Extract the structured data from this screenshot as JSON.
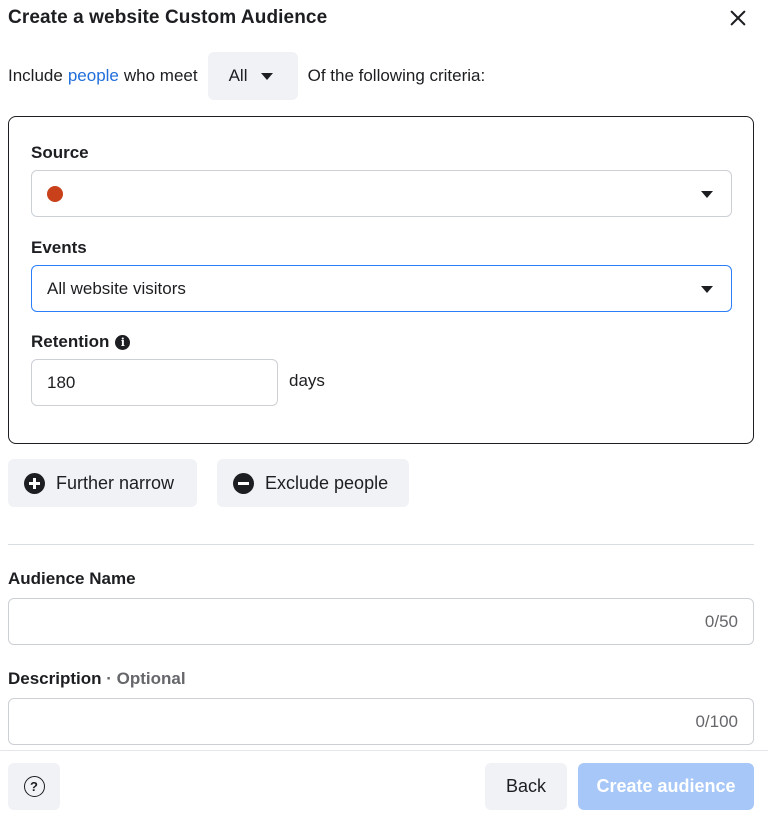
{
  "dialog": {
    "title": "Create a website Custom Audience",
    "close_icon": "close-icon"
  },
  "include": {
    "prefix": "Include",
    "link": "people",
    "middle": "who meet",
    "selector_value": "All",
    "suffix": "Of the following criteria:"
  },
  "criteria": {
    "source_label": "Source",
    "source_value": "",
    "source_dot_color": "#c9411b",
    "events_label": "Events",
    "events_value": "All website visitors",
    "retention_label": "Retention",
    "retention_info_icon": "info-icon",
    "retention_value": "180",
    "retention_unit": "days"
  },
  "actions": {
    "narrow_label": "Further narrow",
    "narrow_icon": "plus-circle-icon",
    "exclude_label": "Exclude people",
    "exclude_icon": "minus-circle-icon"
  },
  "audience_name": {
    "label": "Audience Name",
    "value": "",
    "counter": "0/50"
  },
  "description": {
    "label": "Description",
    "optional": "· Optional",
    "value": "",
    "counter": "0/100"
  },
  "footer": {
    "help_icon": "help-icon",
    "back_label": "Back",
    "create_label": "Create audience"
  },
  "colors": {
    "link": "#216fdb",
    "primary_disabled": "#a6c7f7",
    "secondary_bg": "#f0f2f5",
    "focus_border": "#2d7ff9"
  }
}
